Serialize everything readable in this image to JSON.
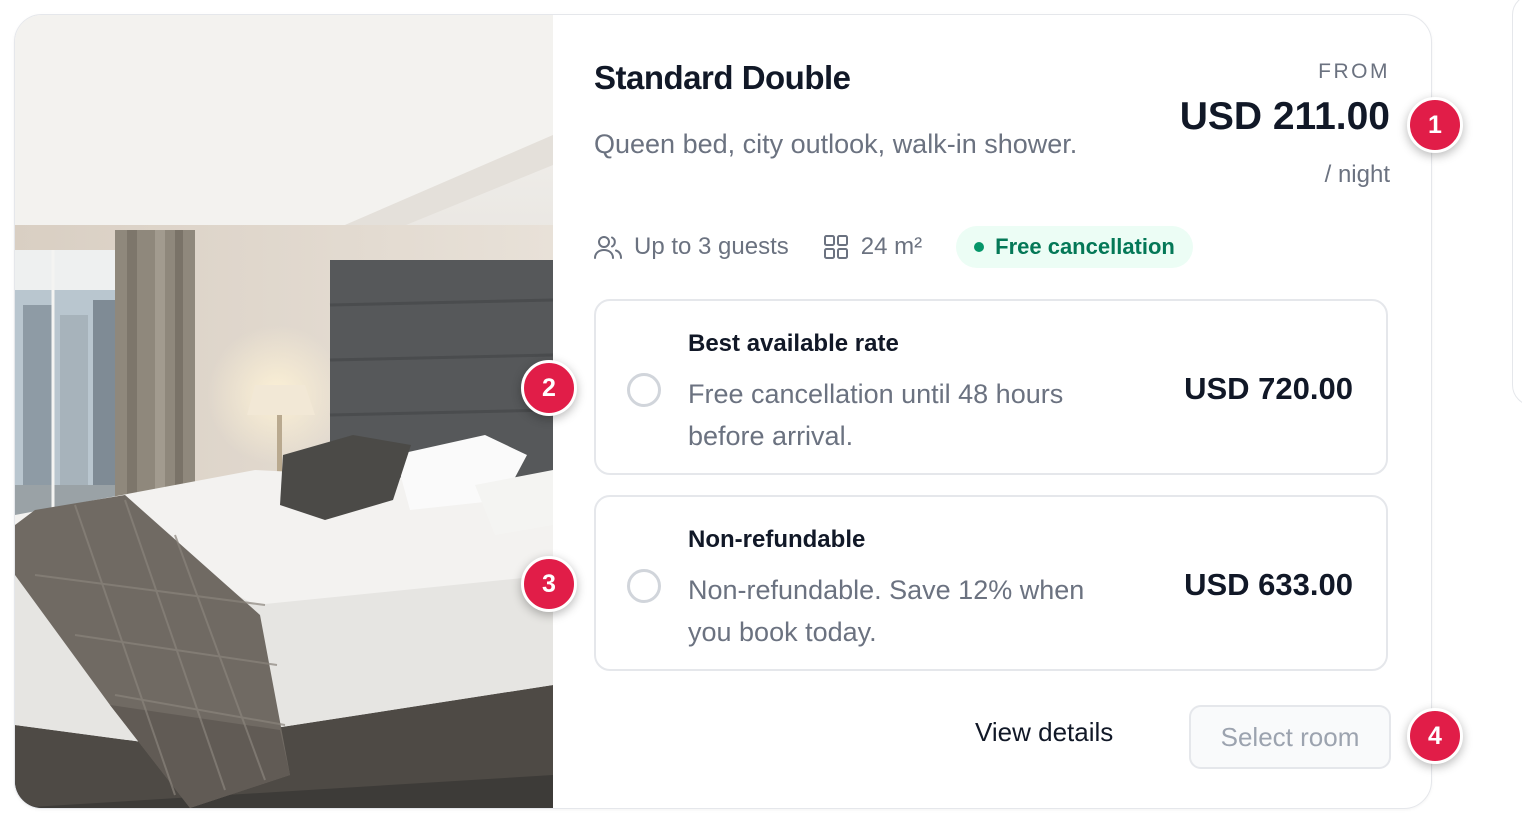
{
  "room": {
    "title": "Standard Double",
    "description": "Queen bed, city outlook, walk-in shower.",
    "price_label": "FROM",
    "price": "USD 211.00",
    "price_unit": "/ night",
    "guests": "Up to 3 guests",
    "size": "24 m²",
    "badge": "Free cancellation"
  },
  "rates": [
    {
      "name": "Best available rate",
      "description": "Free cancellation until 48 hours before arrival.",
      "price": "USD 720.00",
      "selected": false
    },
    {
      "name": "Non-refundable",
      "description": "Non-refundable. Save 12% when you book today.",
      "price": "USD 633.00",
      "selected": false
    }
  ],
  "actions": {
    "view_details": "View details",
    "select_room": "Select room"
  },
  "markers": [
    "1",
    "2",
    "3",
    "4"
  ],
  "colors": {
    "accent_green": "#047857",
    "badge_bg": "#ecfdf5",
    "marker": "#e11d48",
    "muted_text": "#6b7280"
  }
}
